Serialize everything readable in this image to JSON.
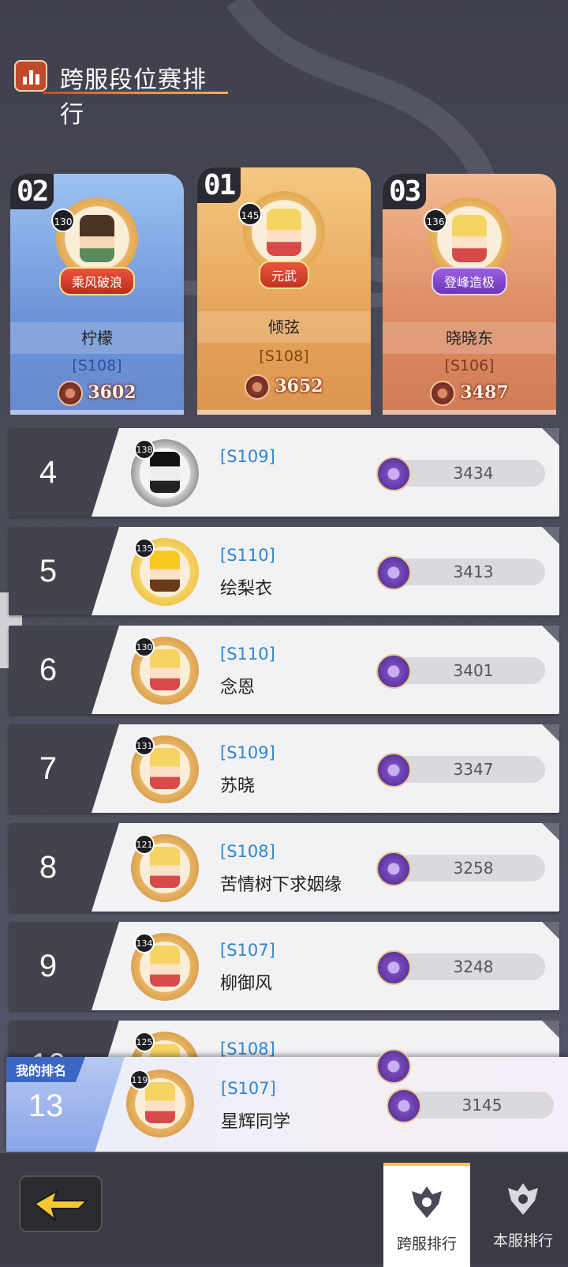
{
  "header": {
    "title": "跨服段位赛排行"
  },
  "podium": [
    {
      "place": "02",
      "level": "130",
      "title": "乘风破浪",
      "name": "柠檬",
      "server": "[S108]",
      "score": "3602"
    },
    {
      "place": "01",
      "level": "145",
      "title": "元武",
      "name": "倾弦",
      "server": "[S108]",
      "score": "3652"
    },
    {
      "place": "03",
      "level": "136",
      "title": "登峰造极",
      "name": "晓晓东",
      "server": "[S106]",
      "score": "3487"
    }
  ],
  "rows": [
    {
      "rank": "4",
      "level": "138",
      "server": "[S109]",
      "name": "",
      "score": "3434"
    },
    {
      "rank": "5",
      "level": "135",
      "server": "[S110]",
      "name": "绘梨衣",
      "score": "3413"
    },
    {
      "rank": "6",
      "level": "130",
      "server": "[S110]",
      "name": "念恩",
      "score": "3401"
    },
    {
      "rank": "7",
      "level": "131",
      "server": "[S109]",
      "name": "苏晓",
      "score": "3347"
    },
    {
      "rank": "8",
      "level": "121",
      "server": "[S108]",
      "name": "苦情树下求姻缘",
      "score": "3258"
    },
    {
      "rank": "9",
      "level": "134",
      "server": "[S107]",
      "name": "柳御风",
      "score": "3248"
    },
    {
      "rank": "10",
      "level": "125",
      "server": "[S108]",
      "name": "",
      "score": ""
    }
  ],
  "my_rank": {
    "label": "我的排名",
    "rank": "13",
    "level": "119",
    "server": "[S107]",
    "name": "星辉同学",
    "score": "3145"
  },
  "footer": {
    "tabs": [
      {
        "label": "跨服排行",
        "active": true
      },
      {
        "label": "本服排行",
        "active": false
      }
    ]
  },
  "colors": {
    "accent": "#f5c833",
    "server_blue": "#2f86d0",
    "rank_panel": "#43434e"
  }
}
